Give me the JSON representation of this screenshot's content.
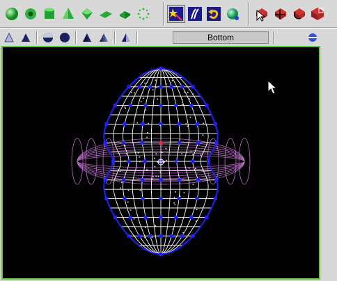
{
  "toolbar": {
    "primitive_icons": [
      "sphere-icon",
      "torus-icon",
      "cylinder-icon",
      "cone-icon",
      "box-icon",
      "plane-icon",
      "disc-icon",
      "points-icon"
    ],
    "action_icons": [
      "magic-wand-icon",
      "spline-icon",
      "undo-arrow-icon",
      "ball-icon"
    ],
    "select_icons": [
      "select-cursor-icon",
      "move-icon",
      "rotate-icon",
      "scale-icon"
    ]
  },
  "view_toolbar": {
    "shading_icons": [
      "wireframe-icon",
      "flat-icon",
      "half-sphere-icon",
      "solid-sphere-icon",
      "shaded-cone-icon",
      "smooth-cone-icon",
      "transparent-cone-icon"
    ],
    "view_name": "Bottom",
    "maximize_icon": "view-toggle-icon"
  },
  "viewport": {
    "background": "#000000",
    "frame_color": "#5ac83c",
    "mesh_color": "#2020ff",
    "wire_color": "#ffffff",
    "torus_color": "#c070d0",
    "cursor": "mouse-pointer-icon"
  }
}
